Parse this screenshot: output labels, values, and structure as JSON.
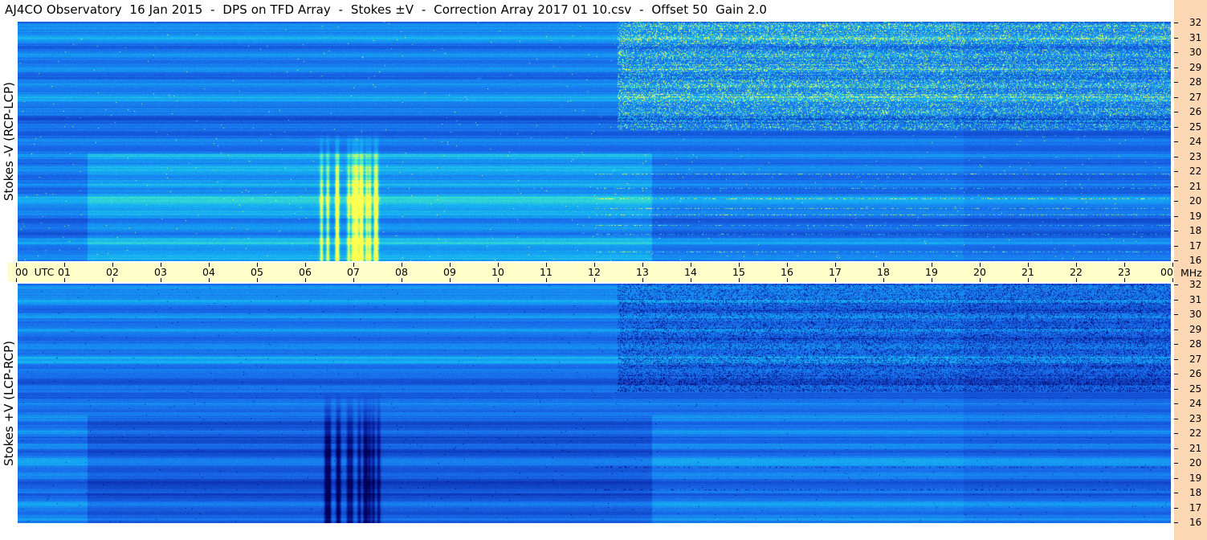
{
  "title": "AJ4CO Observatory  16 Jan 2015  -  DPS on TFD Array  -  Stokes ±V  -  Correction Array 2017 01 10.csv  -  Offset 50  Gain 2.0",
  "panels": [
    {
      "ylabel": "Stokes -V (RCP-LCP)",
      "polarity": "-V"
    },
    {
      "ylabel": "Stokes +V (LCP-RCP)",
      "polarity": "+V"
    }
  ],
  "utc_axis": {
    "unit_label": "UTC",
    "ticks": [
      "00",
      "01",
      "02",
      "03",
      "04",
      "05",
      "06",
      "07",
      "08",
      "09",
      "10",
      "11",
      "12",
      "13",
      "14",
      "15",
      "16",
      "17",
      "18",
      "19",
      "20",
      "21",
      "22",
      "23",
      "00"
    ]
  },
  "freq_axis": {
    "unit_label": "MHz",
    "upper_ticks": [
      "32",
      "31",
      "30",
      "29",
      "28",
      "27",
      "26",
      "25",
      "24",
      "23",
      "22",
      "21",
      "20",
      "19",
      "18",
      "17",
      "16"
    ],
    "lower_ticks": [
      "32",
      "31",
      "30",
      "29",
      "28",
      "27",
      "26",
      "25",
      "24",
      "23",
      "22",
      "21",
      "20",
      "19",
      "18",
      "17",
      "16"
    ]
  },
  "colors": {
    "background": "#ffffff",
    "utc_strip": "#fffec8",
    "freq_strip": "#fbd7b3",
    "colormap_low": "#000066",
    "colormap_mid": "#1e6cf0",
    "colormap_high": "#ffff55"
  },
  "chart_data": {
    "type": "heatmap",
    "title": "AJ4CO Observatory  16 Jan 2015  -  DPS on TFD Array  -  Stokes ±V  -  Correction Array 2017 01 10.csv  -  Offset 50  Gain 2.0",
    "x_axis": {
      "label": "UTC",
      "range": [
        "00",
        "00"
      ],
      "unit": "hours"
    },
    "y_axis": {
      "label": "MHz",
      "range": [
        16,
        32
      ]
    },
    "series": [
      {
        "name": "Stokes -V (RCP-LCP)",
        "events": [
          {
            "type": "radio burst",
            "start_utc": "06:15",
            "end_utc": "07:30",
            "freq_mhz": [
              16,
              24
            ]
          }
        ]
      },
      {
        "name": "Stokes +V (LCP-RCP)",
        "events": [
          {
            "type": "radio burst",
            "start_utc": "06:15",
            "end_utc": "07:30",
            "freq_mhz": [
              16,
              24
            ]
          }
        ]
      }
    ],
    "grid": false,
    "legend": "none"
  }
}
